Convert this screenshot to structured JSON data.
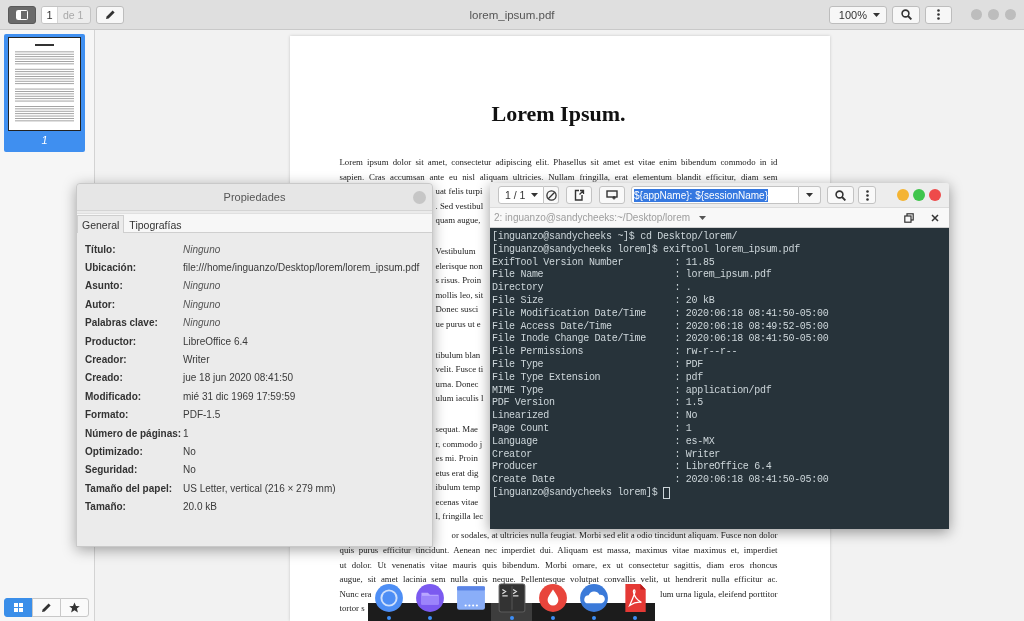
{
  "toolbar": {
    "sidebar_toggle": {
      "pressed": true
    },
    "page_number": "1",
    "page_total": "de 1",
    "title": "lorem_ipsum.pdf",
    "zoom": "100%"
  },
  "sidebar": {
    "thumbnails": [
      {
        "label": "1",
        "selected": true
      }
    ],
    "view_buttons": [
      {
        "kind": "grid",
        "selected": true
      },
      {
        "kind": "pencil",
        "selected": false
      },
      {
        "kind": "star",
        "selected": false
      }
    ]
  },
  "document": {
    "title": "Lorem Ipsum.",
    "paragraphs": [
      {
        "lines": [
          {
            "kind": "full",
            "text": "Lorem ipsum dolor sit amet, consectetur adipiscing elit. Phasellus sit amet est vitae enim bibendum commodo in id"
          },
          {
            "kind": "full",
            "text": "sapien. Cras accumsan ante eu nisl aliquam ultricies. Nullam fringilla, erat elementum blandit efficitur, diam sem"
          },
          {
            "kind": "gap",
            "text": "uat felis turpi"
          },
          {
            "kind": "gap",
            "text": ". Sed vestibul"
          },
          {
            "kind": "gap",
            "text": "quam augue,"
          }
        ]
      },
      {
        "lines": [
          {
            "kind": "gap",
            "text": "Vestibulum"
          },
          {
            "kind": "gap",
            "text": "elerisque non"
          },
          {
            "kind": "gap",
            "text": "s risus. Proin"
          },
          {
            "kind": "gap",
            "text": "mollis leo, sit"
          },
          {
            "kind": "gap",
            "text": "Donec susci"
          },
          {
            "kind": "gap",
            "text": "ue purus ut e"
          }
        ]
      },
      {
        "lines": [
          {
            "kind": "gap",
            "text": "tibulum blan"
          },
          {
            "kind": "gap",
            "text": "velit. Fusce ti"
          },
          {
            "kind": "gap",
            "text": "urna. Donec"
          },
          {
            "kind": "gap",
            "text": "ulum iaculis l"
          }
        ]
      },
      {
        "lines": [
          {
            "kind": "gap",
            "text": "sequat. Mae"
          },
          {
            "kind": "gap",
            "text": "r, commodo j"
          },
          {
            "kind": "gap",
            "text": "es mi. Proin"
          },
          {
            "kind": "gap",
            "text": "etus erat dig"
          },
          {
            "kind": "gap",
            "text": "ibulum temp"
          },
          {
            "kind": "gap",
            "text": "ecenas vitae"
          },
          {
            "kind": "gap",
            "text": "l, fringilla lec"
          }
        ]
      },
      {
        "lines": [
          {
            "kind": "tail",
            "text": "or sodales, at ultricies nulla feugiat. Morbi sed elit a odio tincidunt aliquam. Fusce non dolor"
          },
          {
            "kind": "full",
            "text": "quis purus efficitur tincidunt. Aenean nec imperdiet dui. Aliquam est massa, maximus vitae maximus et, imperdiet"
          },
          {
            "kind": "full",
            "text": "ut dolor. Ut venenatis vitae mauris quis bibendum. Morbi ornare, ex ut consectetur sagittis, diam eros rhoncus"
          },
          {
            "kind": "full",
            "text": "augue, sit amet lacinia sem nulla quis neque. Pellentesque volutpat convallis velit, ut hendrerit nulla efficitur ac."
          },
          {
            "kind": "split",
            "left": "Nunc era",
            "right": "lum urna ligula, eleifend porttitor"
          },
          {
            "kind": "left",
            "text": "tortor s"
          }
        ]
      }
    ]
  },
  "properties_dialog": {
    "title": "Propiedades",
    "tabs": [
      {
        "label": "General",
        "selected": true
      },
      {
        "label": "Tipografías",
        "selected": false
      }
    ],
    "rows": [
      {
        "label": "Título:",
        "value": "Ninguno",
        "kind": "unset"
      },
      {
        "label": "Ubicación:",
        "value": "file:///home/inguanzo/Desktop/lorem/lorem_ipsum.pdf",
        "kind": "set"
      },
      {
        "label": "Asunto:",
        "value": "Ninguno",
        "kind": "unset"
      },
      {
        "label": "Autor:",
        "value": "Ninguno",
        "kind": "unset"
      },
      {
        "label": "Palabras clave:",
        "value": "Ninguno",
        "kind": "unset"
      },
      {
        "label": "Productor:",
        "value": "LibreOffice 6.4",
        "kind": "set"
      },
      {
        "label": "Creador:",
        "value": "Writer",
        "kind": "set"
      },
      {
        "label": "Creado:",
        "value": "jue 18 jun 2020 08:41:50",
        "kind": "set"
      },
      {
        "label": "Modificado:",
        "value": "mié 31 dic 1969 17:59:59",
        "kind": "set"
      },
      {
        "label": "Formato:",
        "value": "PDF-1.5",
        "kind": "set"
      },
      {
        "label": "Número de páginas:",
        "value": "1",
        "kind": "set"
      },
      {
        "label": "Optimizado:",
        "value": "No",
        "kind": "set"
      },
      {
        "label": "Seguridad:",
        "value": "No",
        "kind": "set"
      },
      {
        "label": "Tamaño del papel:",
        "value": "US Letter, vertical (216 × 279 mm)",
        "kind": "set"
      },
      {
        "label": "Tamaño:",
        "value": "20.0 kB",
        "kind": "set"
      }
    ]
  },
  "terminal": {
    "session": "1 / 1",
    "title_field": {
      "value": "${appName}: ${sessionName}",
      "highlighted": true
    },
    "tab_title": "2: inguanzo@sandycheeks:~/Desktop/lorem",
    "lines": [
      "[inguanzo@sandycheeks ~]$ cd Desktop/lorem/",
      "[inguanzo@sandycheeks lorem]$ exiftool lorem_ipsum.pdf",
      "ExifTool Version Number         : 11.85",
      "File Name                       : lorem_ipsum.pdf",
      "Directory                       : .",
      "File Size                       : 20 kB",
      "File Modification Date/Time     : 2020:06:18 08:41:50-05:00",
      "File Access Date/Time           : 2020:06:18 08:49:52-05:00",
      "File Inode Change Date/Time     : 2020:06:18 08:41:50-05:00",
      "File Permissions                : rw-r--r--",
      "File Type                       : PDF",
      "File Type Extension             : pdf",
      "MIME Type                       : application/pdf",
      "PDF Version                     : 1.5",
      "Linearized                      : No",
      "Page Count                      : 1",
      "Language                        : es-MX",
      "Creator                         : Writer",
      "Producer                        : LibreOffice 6.4",
      "Create Date                     : 2020:06:18 08:41:50-05:00"
    ],
    "prompt": "[inguanzo@sandycheeks lorem]$"
  },
  "dock": {
    "items": [
      {
        "kind": "ring",
        "running": true,
        "active": false
      },
      {
        "kind": "folder",
        "running": true,
        "active": false
      },
      {
        "kind": "window",
        "running": false,
        "active": false
      },
      {
        "kind": "terminal",
        "running": true,
        "active": true
      },
      {
        "kind": "drop",
        "running": true,
        "active": false
      },
      {
        "kind": "cloud",
        "running": true,
        "active": false
      },
      {
        "kind": "document",
        "running": true,
        "active": false
      }
    ]
  }
}
